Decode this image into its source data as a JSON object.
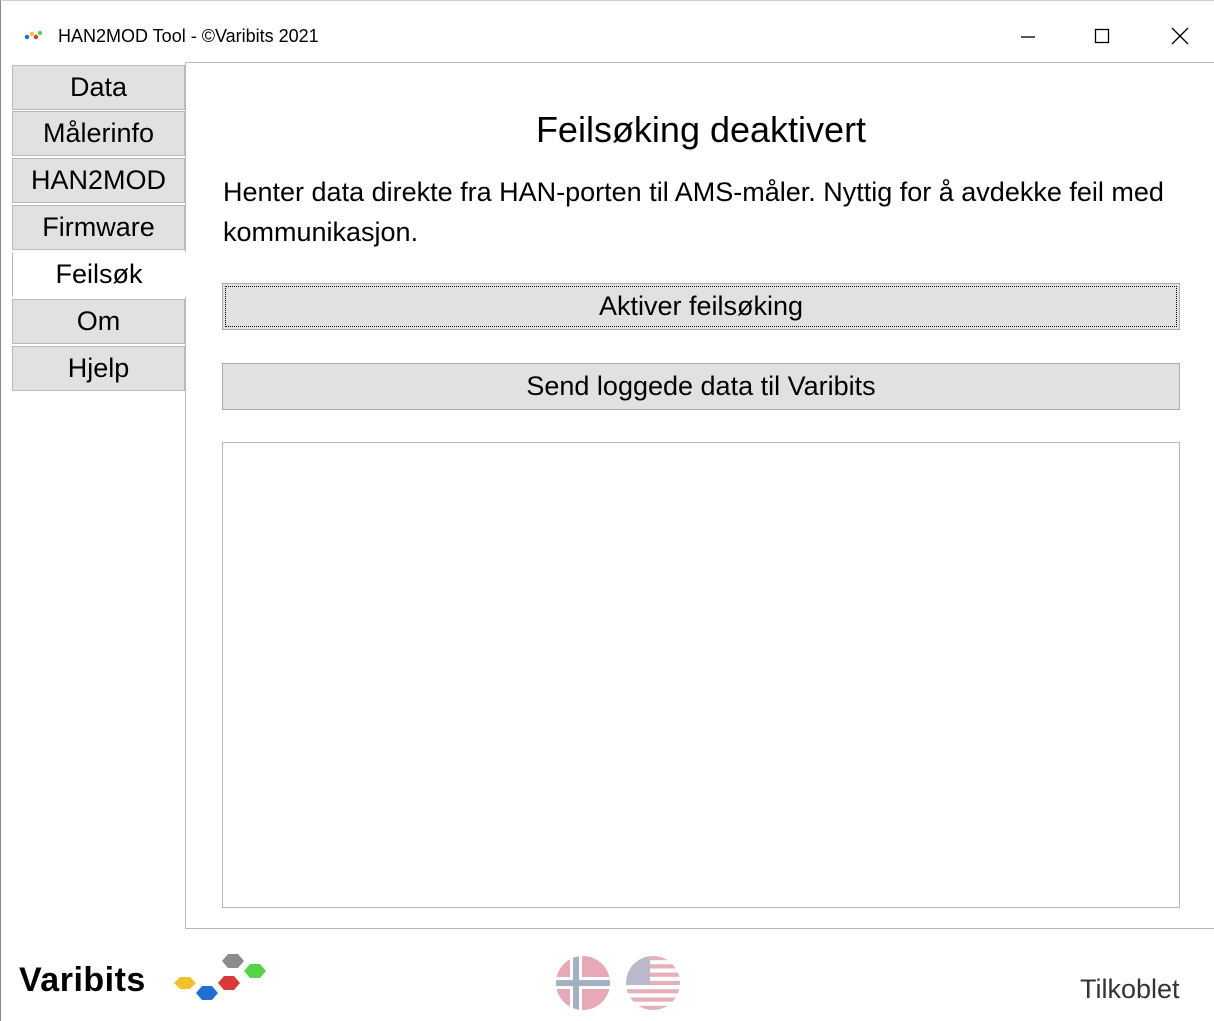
{
  "window": {
    "title": "HAN2MOD Tool - ©Varibits 2021",
    "controls": {
      "minimize_icon": "minimize-icon",
      "maximize_icon": "maximize-icon",
      "close_icon": "close-icon"
    }
  },
  "sidebar": {
    "items": [
      {
        "label": "Data",
        "active": false
      },
      {
        "label": "Målerinfo",
        "active": false
      },
      {
        "label": "HAN2MOD",
        "active": false
      },
      {
        "label": "Firmware",
        "active": false
      },
      {
        "label": "Feilsøk",
        "active": true
      },
      {
        "label": "Om",
        "active": false
      },
      {
        "label": "Hjelp",
        "active": false
      }
    ]
  },
  "main": {
    "title": "Feilsøking deaktivert",
    "description": "Henter data direkte fra HAN-porten til AMS-måler. Nyttig for å avdekke feil med kommunikasjon.",
    "activate_button": "Aktiver feilsøking",
    "send_button": "Send loggede data til Varibits",
    "log_text": ""
  },
  "footer": {
    "brand": "Varibits",
    "flags": [
      "norway-flag-icon",
      "usa-flag-icon"
    ],
    "status": "Tilkoblet"
  },
  "colors": {
    "tab_background": "#e1e1e1",
    "button_background": "#e1e1e1",
    "border": "#b9b9b9",
    "logo_yellow": "#f2c12e",
    "logo_blue": "#1f6fd1",
    "logo_red": "#d63a3a",
    "logo_green": "#55d44a",
    "logo_gray": "#8c8c8c"
  }
}
